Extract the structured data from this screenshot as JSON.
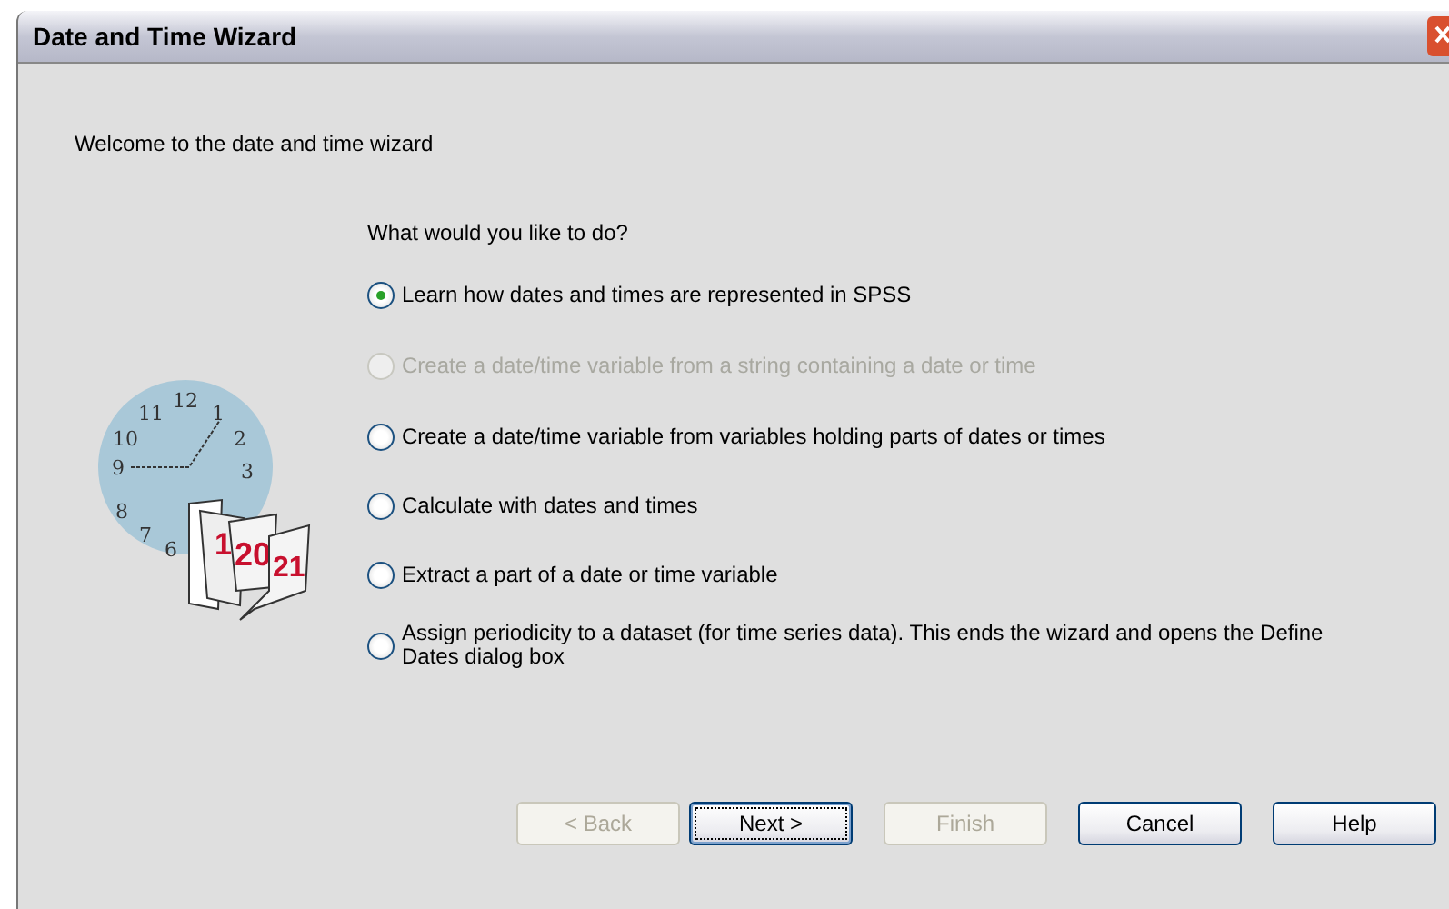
{
  "window": {
    "title": "Date and Time Wizard"
  },
  "welcome": "Welcome to the date and time wizard",
  "question": "What would you like to do?",
  "illustration": {
    "clock_numbers": [
      "12",
      "11",
      "1",
      "10",
      "2",
      "9",
      "3",
      "8",
      "7",
      "6"
    ],
    "calendar_pages": [
      "1",
      "20",
      "21"
    ]
  },
  "options": [
    {
      "label": "Learn how dates and times are represented in SPSS",
      "selected": true,
      "disabled": false
    },
    {
      "label": "Create a date/time variable from a string containing a date or time",
      "selected": false,
      "disabled": true
    },
    {
      "label": "Create a date/time variable from  variables holding parts of dates or times",
      "selected": false,
      "disabled": false
    },
    {
      "label": "Calculate with dates and times",
      "selected": false,
      "disabled": false
    },
    {
      "label": "Extract a part of a date or time variable",
      "selected": false,
      "disabled": false
    },
    {
      "label": "Assign periodicity to a dataset (for time series data). This ends the wizard and opens the Define Dates dialog box",
      "selected": false,
      "disabled": false
    }
  ],
  "buttons": [
    {
      "label": "< Back",
      "disabled": true,
      "focused": false
    },
    {
      "label": "Next >",
      "disabled": false,
      "focused": true
    },
    {
      "label": "Finish",
      "disabled": true,
      "focused": false
    },
    {
      "label": "Cancel",
      "disabled": false,
      "focused": false
    },
    {
      "label": "Help",
      "disabled": false,
      "focused": false
    }
  ]
}
